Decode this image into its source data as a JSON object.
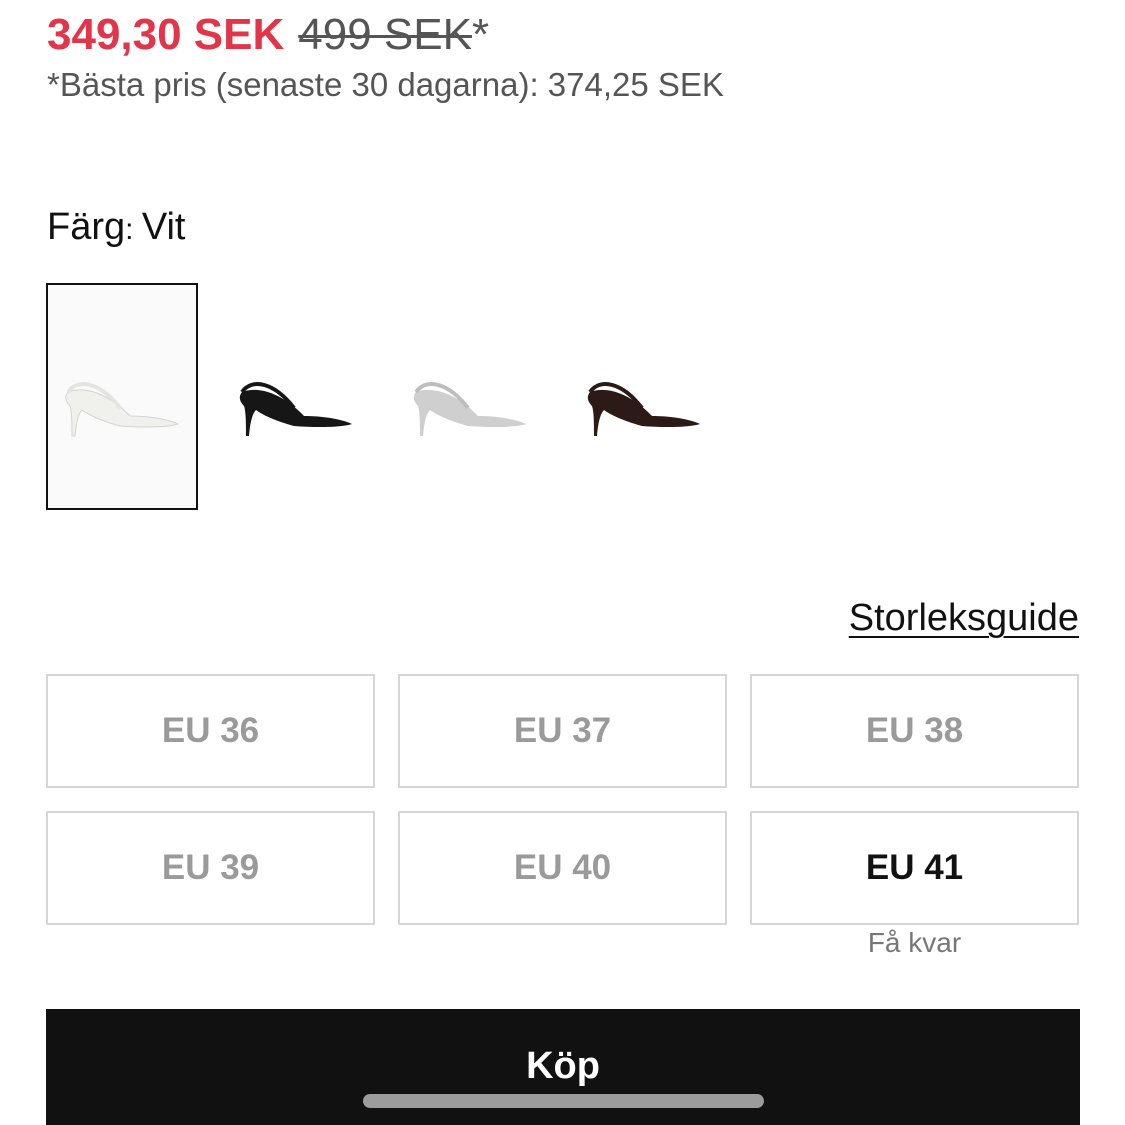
{
  "price": {
    "sale": "349,30 SEK",
    "original": "499 SEK",
    "original_suffix": "*",
    "best_price_note": "*Bästa pris (senaste 30 dagarna): 374,25 SEK"
  },
  "color": {
    "label": "Färg",
    "separator": ": ",
    "value": "Vit",
    "swatches": [
      {
        "name": "white",
        "color": "#f0f0ec",
        "selected": true
      },
      {
        "name": "black",
        "color": "#161616",
        "selected": false
      },
      {
        "name": "light-grey",
        "color": "#cfcfcf",
        "selected": false
      },
      {
        "name": "dark-brown",
        "color": "#2b1a16",
        "selected": false
      }
    ]
  },
  "size_guide_label": "Storleksguide",
  "sizes": [
    {
      "label": "EU 36",
      "available": false,
      "note": ""
    },
    {
      "label": "EU 37",
      "available": false,
      "note": ""
    },
    {
      "label": "EU 38",
      "available": false,
      "note": ""
    },
    {
      "label": "EU 39",
      "available": false,
      "note": ""
    },
    {
      "label": "EU 40",
      "available": false,
      "note": ""
    },
    {
      "label": "EU 41",
      "available": true,
      "note": "Få kvar"
    }
  ],
  "buy_label": "Köp"
}
